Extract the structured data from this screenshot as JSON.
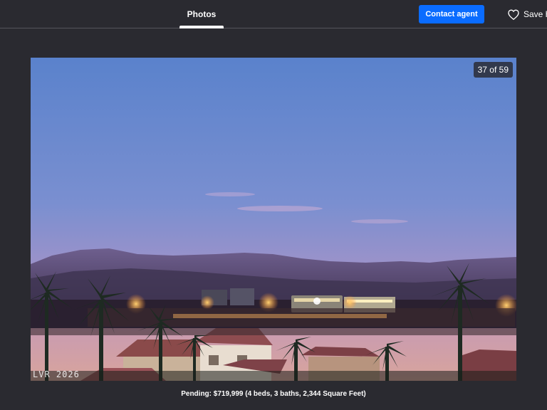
{
  "header": {
    "tab_photos_label": "Photos",
    "contact_button_label": "Contact agent",
    "save_label": "Save H",
    "save_icon": "heart-icon"
  },
  "photo": {
    "counter_text": "37 of 59",
    "watermark_text": "LVR 2026",
    "alt": "Dusk view over rooftops and palm trees toward lit stadium and mountains"
  },
  "listing": {
    "caption": "Pending: $719,999 (4 beds, 3 baths, 2,344 Square Feet)"
  },
  "colors": {
    "background": "#2a2a30",
    "accent_button": "#0a6cff",
    "text": "#ffffff"
  }
}
